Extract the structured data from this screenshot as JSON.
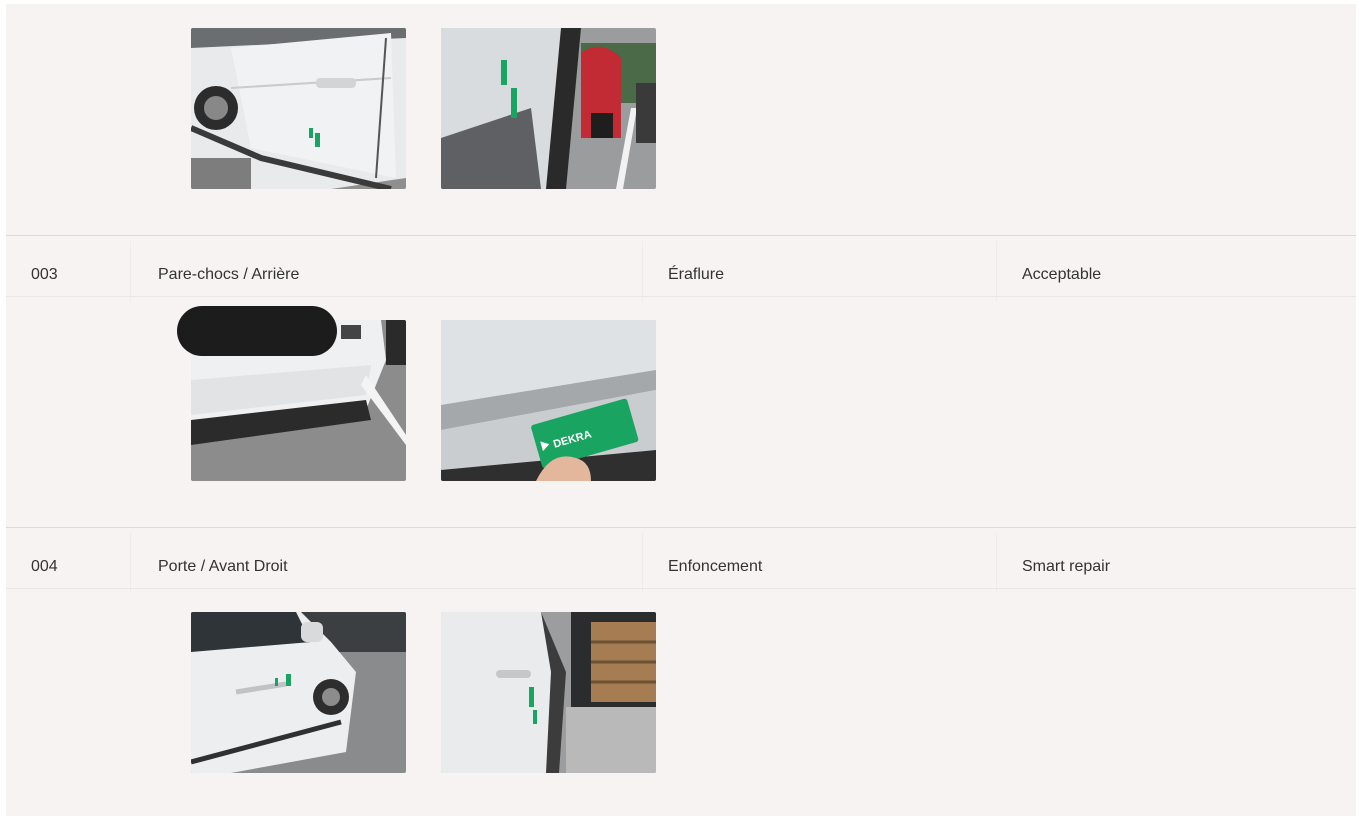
{
  "rows": [
    {
      "id": "003",
      "part": "Pare-chocs / Arrière",
      "damage": "Éraflure",
      "status": "Acceptable"
    },
    {
      "id": "004",
      "part": "Porte / Avant Droit",
      "damage": "Enfoncement",
      "status": "Smart repair"
    }
  ],
  "gauge_text": "DEKRA",
  "colors": {
    "panel_bg": "#f7f3f2",
    "divider": "#dedad9",
    "text": "#333333",
    "gauge_green": "#1aa461"
  }
}
